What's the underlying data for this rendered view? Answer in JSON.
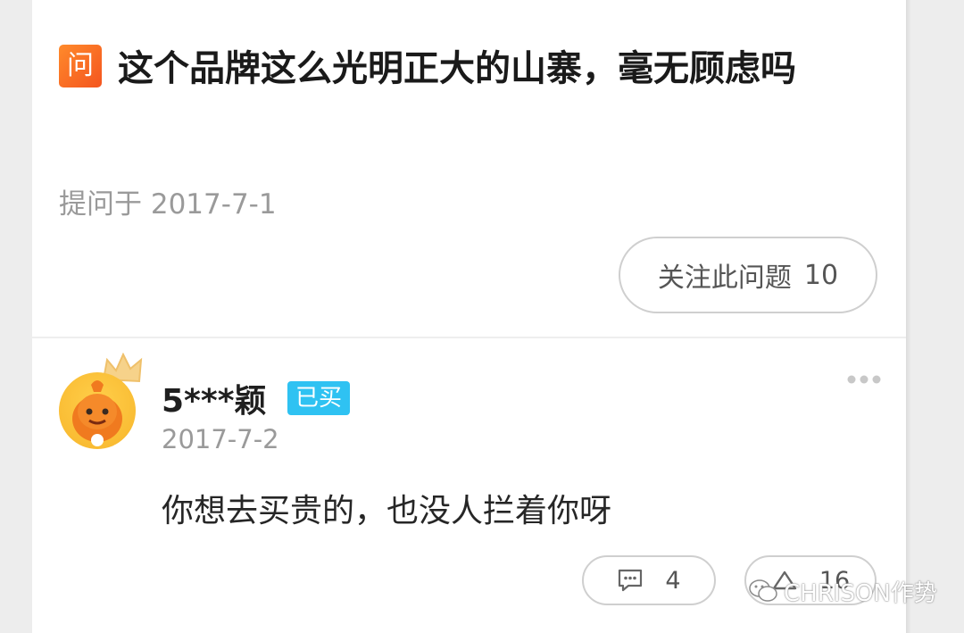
{
  "question": {
    "badge": "问",
    "title": "这个品牌这么光明正大的山寨，毫无顾虑吗",
    "asked_label": "提问于",
    "asked_date": "2017-7-1",
    "follow_label": "关注此问题",
    "follow_count": "10"
  },
  "answer": {
    "username": "5***颖",
    "bought_badge": "已买",
    "date": "2017-7-2",
    "text": "你想去买贵的，也没人拦着你呀",
    "comment_count": "4",
    "like_count": "16"
  },
  "watermark": {
    "text": "CHRISON作势"
  },
  "colors": {
    "badge_orange": "#f4551f",
    "bought_blue": "#2fc2f2",
    "avatar_yellow": "#f7b52b"
  },
  "icons": [
    "more-icon",
    "comment-icon",
    "like-icon",
    "wechat-icon",
    "crown-icon"
  ]
}
